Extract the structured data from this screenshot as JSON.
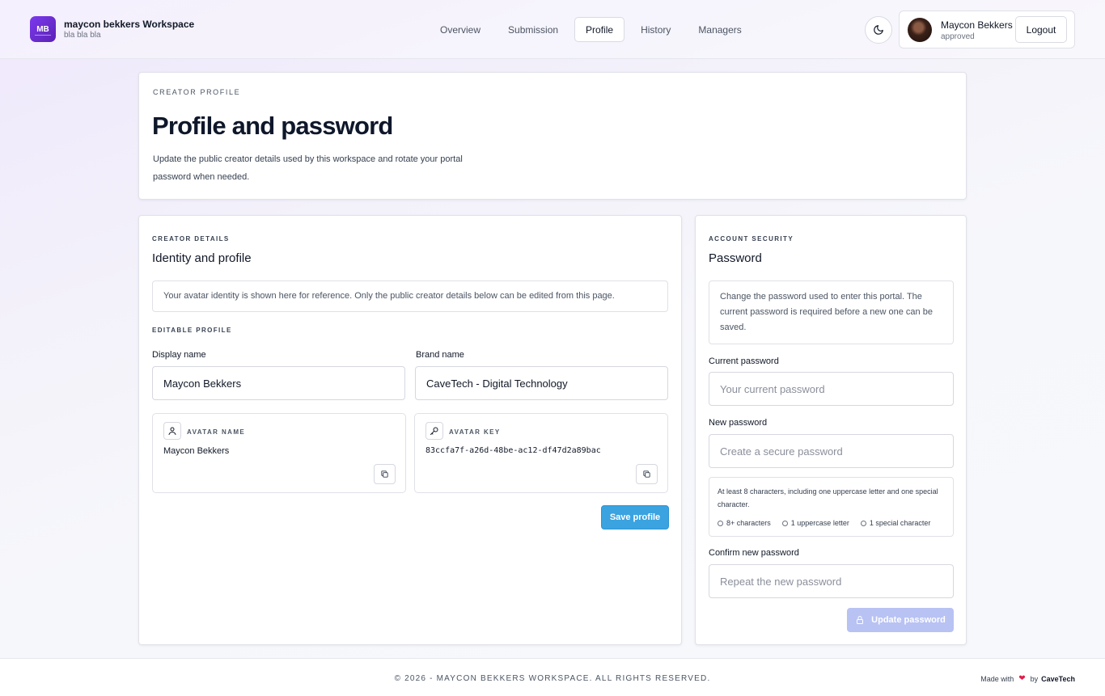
{
  "header": {
    "logo_initials": "MB",
    "workspace_title": "maycon bekkers Workspace",
    "workspace_subtitle": "bla bla bla",
    "nav": [
      {
        "label": "Overview"
      },
      {
        "label": "Submission"
      },
      {
        "label": "Profile"
      },
      {
        "label": "History"
      },
      {
        "label": "Managers"
      }
    ],
    "active_tab": "Profile",
    "user_name": "Maycon Bekkers",
    "user_status": "approved",
    "logout_label": "Logout"
  },
  "hero": {
    "eyebrow": "CREATOR PROFILE",
    "title": "Profile and password",
    "description": "Update the public creator details used by this workspace and rotate your portal password when needed."
  },
  "profile": {
    "eyebrow": "CREATOR DETAILS",
    "title": "Identity and profile",
    "note": "Your avatar identity is shown here for reference. Only the public creator details below can be edited from this page.",
    "editable_eyebrow": "EDITABLE PROFILE",
    "display_name_label": "Display name",
    "display_name_value": "Maycon Bekkers",
    "brand_name_label": "Brand name",
    "brand_name_value": "CaveTech - Digital Technology",
    "avatar_name_label": "AVATAR NAME",
    "avatar_name_value": "Maycon Bekkers",
    "avatar_key_label": "AVATAR KEY",
    "avatar_key_value": "83ccfa7f-a26d-48be-ac12-df47d2a89bac",
    "save_label": "Save profile"
  },
  "security": {
    "eyebrow": "ACCOUNT SECURITY",
    "title": "Password",
    "note": "Change the password used to enter this portal. The current password is required before a new one can be saved.",
    "current_label": "Current password",
    "current_placeholder": "Your current password",
    "new_label": "New password",
    "new_placeholder": "Create a secure password",
    "hint": "At least 8 characters, including one uppercase letter and one special character.",
    "requirements": [
      "8+ characters",
      "1 uppercase letter",
      "1 special character"
    ],
    "confirm_label": "Confirm new password",
    "confirm_placeholder": "Repeat the new password",
    "update_label": "Update password"
  },
  "footer": {
    "copyright": "© 2026 - MAYCON BEKKERS WORKSPACE. ALL RIGHTS RESERVED.",
    "made_with": "Made with",
    "by": "by",
    "made_brand": "CaveTech"
  },
  "colors": {
    "brand_purple": "#6d28d9",
    "save_blue": "#3aa3e0",
    "update_disabled": "#b8c2f3",
    "heart": "#e11d48"
  }
}
